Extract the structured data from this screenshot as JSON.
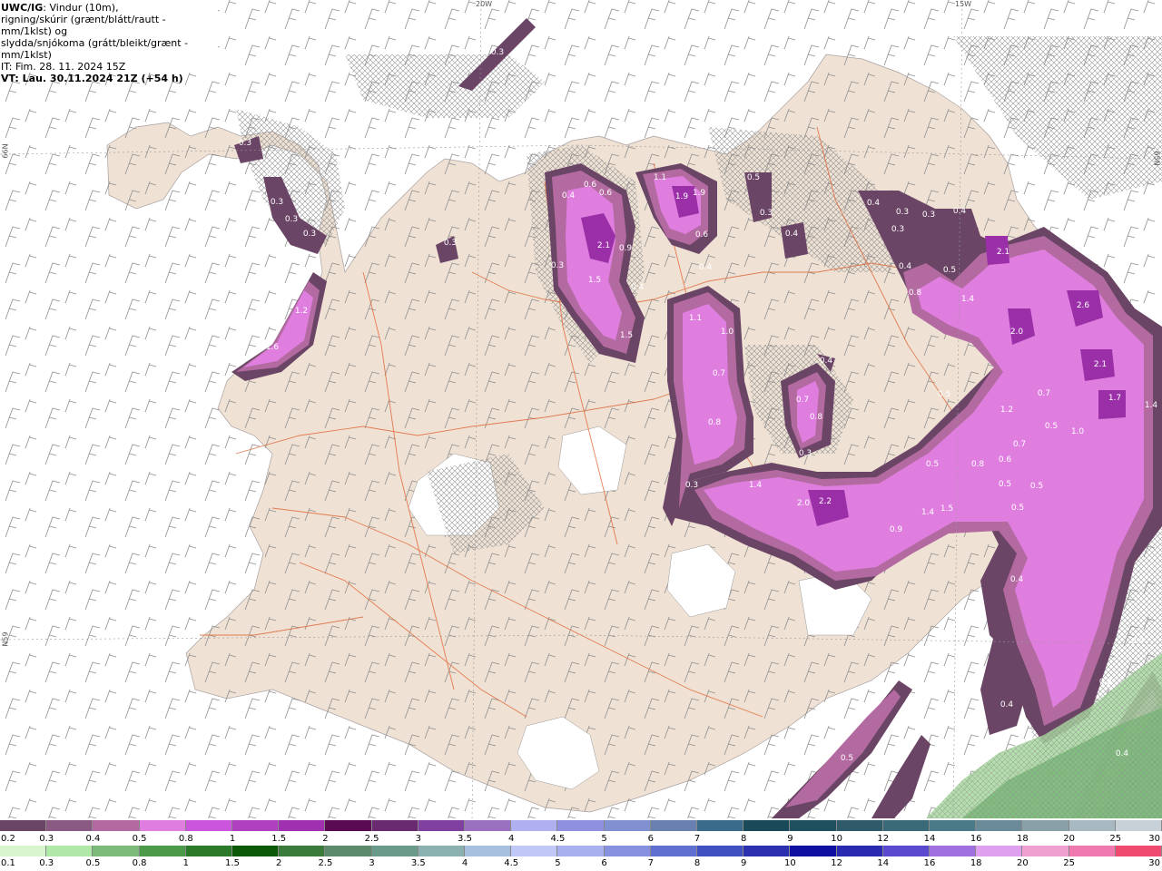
{
  "header": {
    "model": "UWC/IG",
    "line1_rest": ": Vindur (10m),",
    "line2": "rigning/skúrir (grænt/blátt/rautt - mm/1klst) og",
    "line3": "slydda/snjókoma (grátt/bleikt/grænt - mm/1klst)",
    "line4": "IT: Fim. 28. 11. 2024 15Z",
    "line5": "VT: Lau. 30.11.2024 21Z (+54 h)"
  },
  "grid_labels": {
    "lon_20w": "20W",
    "lon_15w": "15W",
    "lat_66n": "66N",
    "lat_65n_right": "65N",
    "lat_65n_left": "N59"
  },
  "colors": {
    "land": "#efe1d4",
    "sea": "#ffffff",
    "roads": "#e06a3a",
    "snow_light": "#b36aa0",
    "snow_strong": "#cc55dd",
    "snow_peak": "#9a2fa8",
    "snow_dark": "#6b4565",
    "rain_green": "#7cba7a"
  },
  "precip_values": [
    {
      "v": "0.3"
    },
    {
      "v": "0.3"
    },
    {
      "v": "0.3"
    },
    {
      "v": "0.3"
    },
    {
      "v": "0.3"
    },
    {
      "v": "0.3"
    },
    {
      "v": "1.2"
    },
    {
      "v": "1.6"
    },
    {
      "v": "0.3"
    },
    {
      "v": "0.4"
    },
    {
      "v": "0.6"
    },
    {
      "v": "0.6"
    },
    {
      "v": "2.1"
    },
    {
      "v": "0.9"
    },
    {
      "v": "1.5"
    },
    {
      "v": "0.3"
    },
    {
      "v": "0.4"
    },
    {
      "v": "1.5"
    },
    {
      "v": "1.1"
    },
    {
      "v": "1.9"
    },
    {
      "v": "1.9"
    },
    {
      "v": "0.6"
    },
    {
      "v": "0.4"
    },
    {
      "v": "1.1"
    },
    {
      "v": "1.0"
    },
    {
      "v": "0.7"
    },
    {
      "v": "0.8"
    },
    {
      "v": "0.5"
    },
    {
      "v": "0.3"
    },
    {
      "v": "0.4"
    },
    {
      "v": "0.4"
    },
    {
      "v": "0.3"
    },
    {
      "v": "0.3"
    },
    {
      "v": "0.4"
    },
    {
      "v": "0.3"
    },
    {
      "v": "0.4"
    },
    {
      "v": "0.5"
    },
    {
      "v": "0.8"
    },
    {
      "v": "1.4"
    },
    {
      "v": "2.1"
    },
    {
      "v": "2.0"
    },
    {
      "v": "2.6"
    },
    {
      "v": "2.1"
    },
    {
      "v": "0.4"
    },
    {
      "v": "0.7"
    },
    {
      "v": "0.8"
    },
    {
      "v": "0.3"
    },
    {
      "v": "0.5"
    },
    {
      "v": "1.2"
    },
    {
      "v": "0.7"
    },
    {
      "v": "0.5"
    },
    {
      "v": "1.0"
    },
    {
      "v": "1.7"
    },
    {
      "v": "1.4"
    },
    {
      "v": "0.7"
    },
    {
      "v": "0.5"
    },
    {
      "v": "0.8"
    },
    {
      "v": "0.6"
    },
    {
      "v": "0.5"
    },
    {
      "v": "0.5"
    },
    {
      "v": "0.3"
    },
    {
      "v": "1.4"
    },
    {
      "v": "2.0"
    },
    {
      "v": "2.2"
    },
    {
      "v": "0.9"
    },
    {
      "v": "1.4"
    },
    {
      "v": "1.5"
    },
    {
      "v": "0.5"
    },
    {
      "v": "0.4"
    },
    {
      "v": "0.4"
    },
    {
      "v": "0.2"
    },
    {
      "v": "0.4"
    },
    {
      "v": "0.5"
    },
    {
      "v": "0.4"
    }
  ],
  "legend_snow": {
    "colors": [
      "#6b4565",
      "#8a5a83",
      "#b36aa0",
      "#e07ee0",
      "#cc55dd",
      "#b040c0",
      "#a030b0",
      "#5a0a50",
      "#6a2a70",
      "#8040a0",
      "#9a70c0",
      "#b0b0f0",
      "#9090e0",
      "#8090d0",
      "#6a80b0",
      "#3a6a8a",
      "#1a4a5a",
      "#1e5060",
      "#2e5a6a",
      "#3a6a78",
      "#4a7a88",
      "#6a8a98",
      "#8aa0a8",
      "#a8b8c0",
      "#c8d0d8"
    ],
    "labels": [
      "0.2",
      "0.3",
      "0.4",
      "0.5",
      "0.8",
      "1",
      "1.5",
      "2",
      "2.5",
      "3",
      "3.5",
      "4",
      "4.5",
      "5",
      "6",
      "7",
      "8",
      "9",
      "10",
      "12",
      "14",
      "16",
      "18",
      "20",
      "25",
      "30"
    ]
  },
  "legend_rain": {
    "colors": [
      "#d8f5d0",
      "#b0e8a8",
      "#7cba7a",
      "#4a9a4a",
      "#2a7a2a",
      "#0a5a0a",
      "#3a7a3a",
      "#5a8a6a",
      "#6a9a8a",
      "#8ab0b0",
      "#a8c0e0",
      "#c0c8f8",
      "#a8b0f0",
      "#8890e0",
      "#6070d0",
      "#4050c0",
      "#2a30b0",
      "#1010a0",
      "#2a2ab0",
      "#5a4ad0",
      "#a070e0",
      "#e0a0f0",
      "#f0a0d0",
      "#f07ab0",
      "#f04a70"
    ],
    "labels": [
      "0.1",
      "0.3",
      "0.5",
      "0.8",
      "1",
      "1.5",
      "2",
      "2.5",
      "3",
      "3.5",
      "4",
      "4.5",
      "5",
      "6",
      "7",
      "8",
      "9",
      "10",
      "12",
      "14",
      "16",
      "18",
      "20",
      "25",
      "30"
    ]
  }
}
